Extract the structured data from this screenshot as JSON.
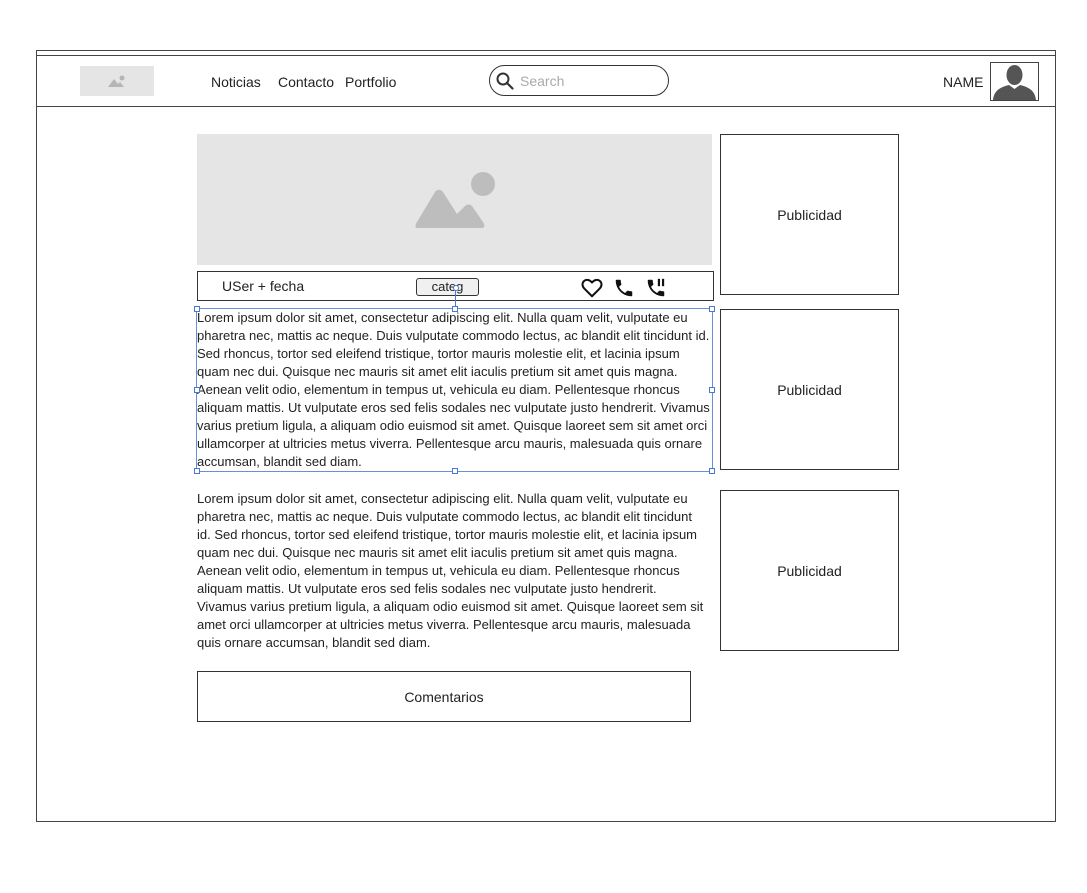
{
  "nav": {
    "items": [
      {
        "label": "Noticias"
      },
      {
        "label": "Contacto"
      },
      {
        "label": "Portfolio"
      }
    ]
  },
  "search": {
    "placeholder": "Search",
    "value": ""
  },
  "user": {
    "name": "NAME"
  },
  "post": {
    "meta": "USer + fecha",
    "category": "categ",
    "paragraph1": "Lorem ipsum dolor sit amet, consectetur adipiscing elit. Nulla quam velit, vulputate eu pharetra nec, mattis ac neque. Duis vulputate commodo lectus, ac blandit elit tincidunt id. Sed rhoncus, tortor sed eleifend tristique, tortor mauris molestie elit, et lacinia ipsum quam nec dui. Quisque nec mauris sit amet elit iaculis pretium sit amet quis magna. Aenean velit odio, elementum in tempus ut, vehicula eu diam. Pellentesque rhoncus aliquam mattis. Ut vulputate eros sed felis sodales nec vulputate justo hendrerit. Vivamus varius pretium ligula, a aliquam odio euismod sit amet. Quisque laoreet sem sit amet orci ullamcorper at ultricies metus viverra. Pellentesque arcu mauris, malesuada quis ornare accumsan, blandit sed diam.",
    "paragraph2": "Lorem ipsum dolor sit amet, consectetur adipiscing elit. Nulla quam velit, vulputate eu pharetra nec, mattis ac neque. Duis vulputate commodo lectus, ac blandit elit tincidunt id. Sed rhoncus, tortor sed eleifend tristique, tortor mauris molestie elit, et lacinia ipsum quam nec dui. Quisque nec mauris sit amet elit iaculis pretium sit amet quis magna. Aenean velit odio, elementum in tempus ut, vehicula eu diam. Pellentesque rhoncus aliquam mattis. Ut vulputate eros sed felis sodales nec vulputate justo hendrerit. Vivamus varius pretium ligula, a aliquam odio euismod sit amet. Quisque laoreet sem sit amet orci ullamcorper at ultricies metus viverra. Pellentesque arcu mauris, malesuada quis ornare accumsan, blandit sed diam.",
    "icons": [
      "heart-icon",
      "phone-icon",
      "phone-call-icon"
    ]
  },
  "ads": [
    {
      "label": "Publicidad"
    },
    {
      "label": "Publicidad"
    },
    {
      "label": "Publicidad"
    }
  ],
  "comments": {
    "label": "Comentarios"
  }
}
